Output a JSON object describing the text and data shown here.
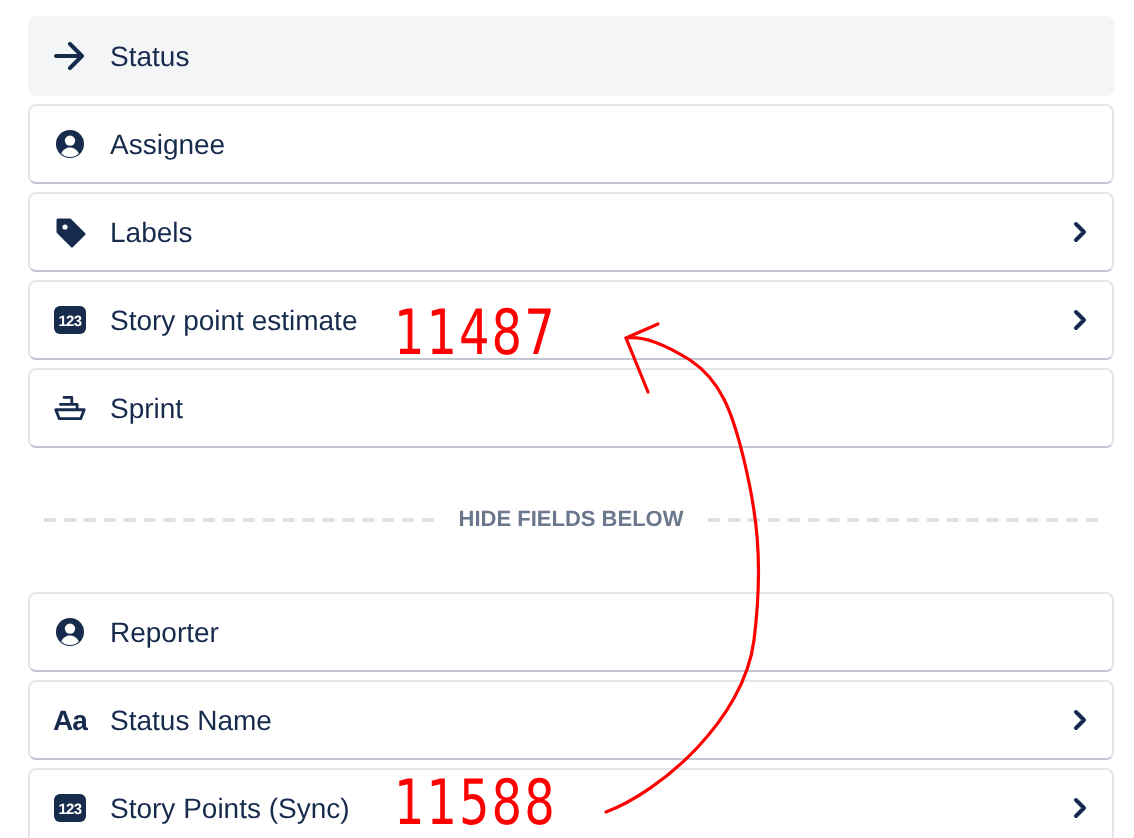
{
  "fields_above": [
    {
      "label": "Status",
      "kind": "arrow",
      "highlighted": true,
      "has_chevron": false
    },
    {
      "label": "Assignee",
      "kind": "person",
      "highlighted": false,
      "has_chevron": false
    },
    {
      "label": "Labels",
      "kind": "tag",
      "highlighted": false,
      "has_chevron": true
    },
    {
      "label": "Story point estimate",
      "kind": "badge",
      "icon_text": "123",
      "highlighted": false,
      "has_chevron": true
    },
    {
      "label": "Sprint",
      "kind": "boat",
      "highlighted": false,
      "has_chevron": false
    }
  ],
  "divider": {
    "label": "HIDE FIELDS BELOW"
  },
  "fields_below": [
    {
      "label": "Reporter",
      "kind": "person",
      "highlighted": false,
      "has_chevron": false
    },
    {
      "label": "Status Name",
      "kind": "glyph",
      "icon_text": "Aa",
      "highlighted": false,
      "has_chevron": true
    },
    {
      "label": "Story Points (Sync)",
      "kind": "badge",
      "icon_text": "123",
      "highlighted": false,
      "has_chevron": true
    }
  ],
  "annotations": [
    {
      "text": "11487"
    },
    {
      "text": "11588"
    }
  ]
}
